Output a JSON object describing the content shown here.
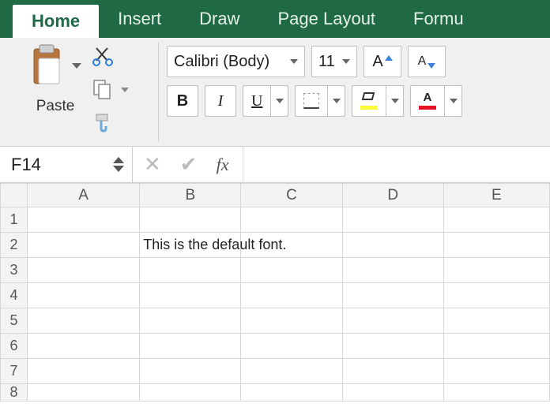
{
  "tabs": {
    "home": "Home",
    "insert": "Insert",
    "draw": "Draw",
    "page_layout": "Page Layout",
    "formulas": "Formu"
  },
  "clipboard": {
    "paste_label": "Paste"
  },
  "font": {
    "name": "Calibri (Body)",
    "size": "11",
    "grow": "A",
    "shrink": "A",
    "bold": "B",
    "italic": "I",
    "underline": "U",
    "font_color_letter": "A"
  },
  "name_box": {
    "value": "F14"
  },
  "formula_bar": {
    "fx": "fx",
    "value": ""
  },
  "columns": [
    "A",
    "B",
    "C",
    "D",
    "E"
  ],
  "rows": [
    "1",
    "2",
    "3",
    "4",
    "5",
    "6",
    "7",
    "8"
  ],
  "cells": {
    "B2": "This is the default font."
  }
}
